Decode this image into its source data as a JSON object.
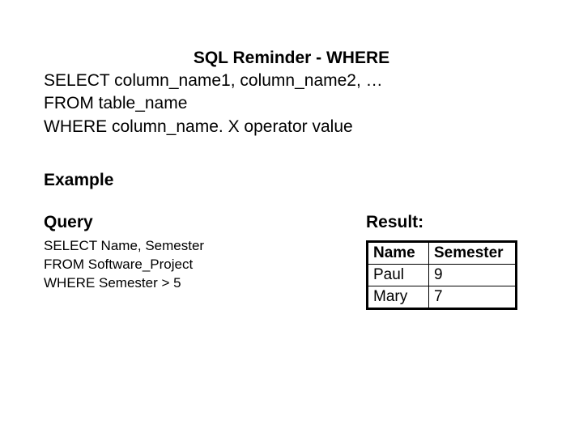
{
  "title": "SQL Reminder - WHERE",
  "syntax": {
    "line1": "SELECT column_name1, column_name2, …",
    "line2": "FROM table_name",
    "line3": "WHERE column_name. X operator value"
  },
  "example_heading": "Example",
  "query": {
    "heading": "Query",
    "line1": "SELECT Name, Semester",
    "line2": "FROM Software_Project",
    "line3": "WHERE Semester > 5"
  },
  "result": {
    "heading": "Result:",
    "headers": {
      "col1": "Name",
      "col2": "Semester"
    },
    "rows": [
      {
        "name": "Paul",
        "semester": "9"
      },
      {
        "name": "Mary",
        "semester": "7"
      }
    ]
  },
  "chart_data": {
    "type": "table",
    "title": "Result:",
    "columns": [
      "Name",
      "Semester"
    ],
    "rows": [
      [
        "Paul",
        9
      ],
      [
        "Mary",
        7
      ]
    ]
  }
}
